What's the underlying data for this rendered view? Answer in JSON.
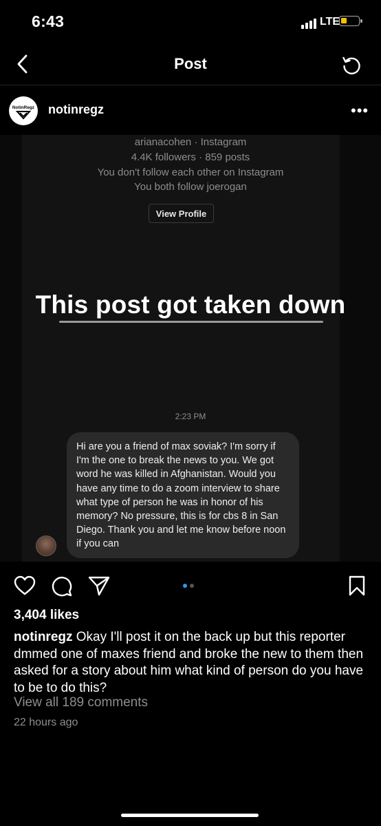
{
  "status_bar": {
    "time": "6:43",
    "network": "LTE",
    "battery_color": "#f5c400"
  },
  "nav": {
    "title": "Post",
    "back_icon": "chevron-left-icon",
    "refresh_icon": "refresh-icon"
  },
  "post": {
    "username": "notinregz",
    "avatar_text": "NotinRegz",
    "more_label": "•••",
    "image": {
      "profile": {
        "handle": "arianacohen · Instagram",
        "stats": "4.4K followers · 859 posts",
        "follow_status": "You don't follow each other on Instagram",
        "mutual": "You both follow joerogan",
        "view_profile_label": "View Profile"
      },
      "headline": "This post got taken down",
      "message_time": "2:23 PM",
      "message": "Hi are you a friend of max soviak? I'm sorry if I'm the one to break the news to you. We got word he was killed in Afghanistan. Would you have any time to do a zoom interview to share what type of person he was in honor of his memory? No pressure, this is for cbs 8 in San Diego. Thank you and let me know before noon if you can"
    },
    "carousel": {
      "current": 1,
      "total": 2,
      "active_color": "#2b9af3"
    },
    "likes": "3,404 likes",
    "caption_user": "notinregz",
    "caption_text": " Okay I'll post it on the back up but this reporter dmmed one of maxes friend and broke the new to them then asked for a story about him what kind of person do you have to be to do this?",
    "comments_link": "View all 189 comments",
    "time_ago": "22 hours ago"
  }
}
